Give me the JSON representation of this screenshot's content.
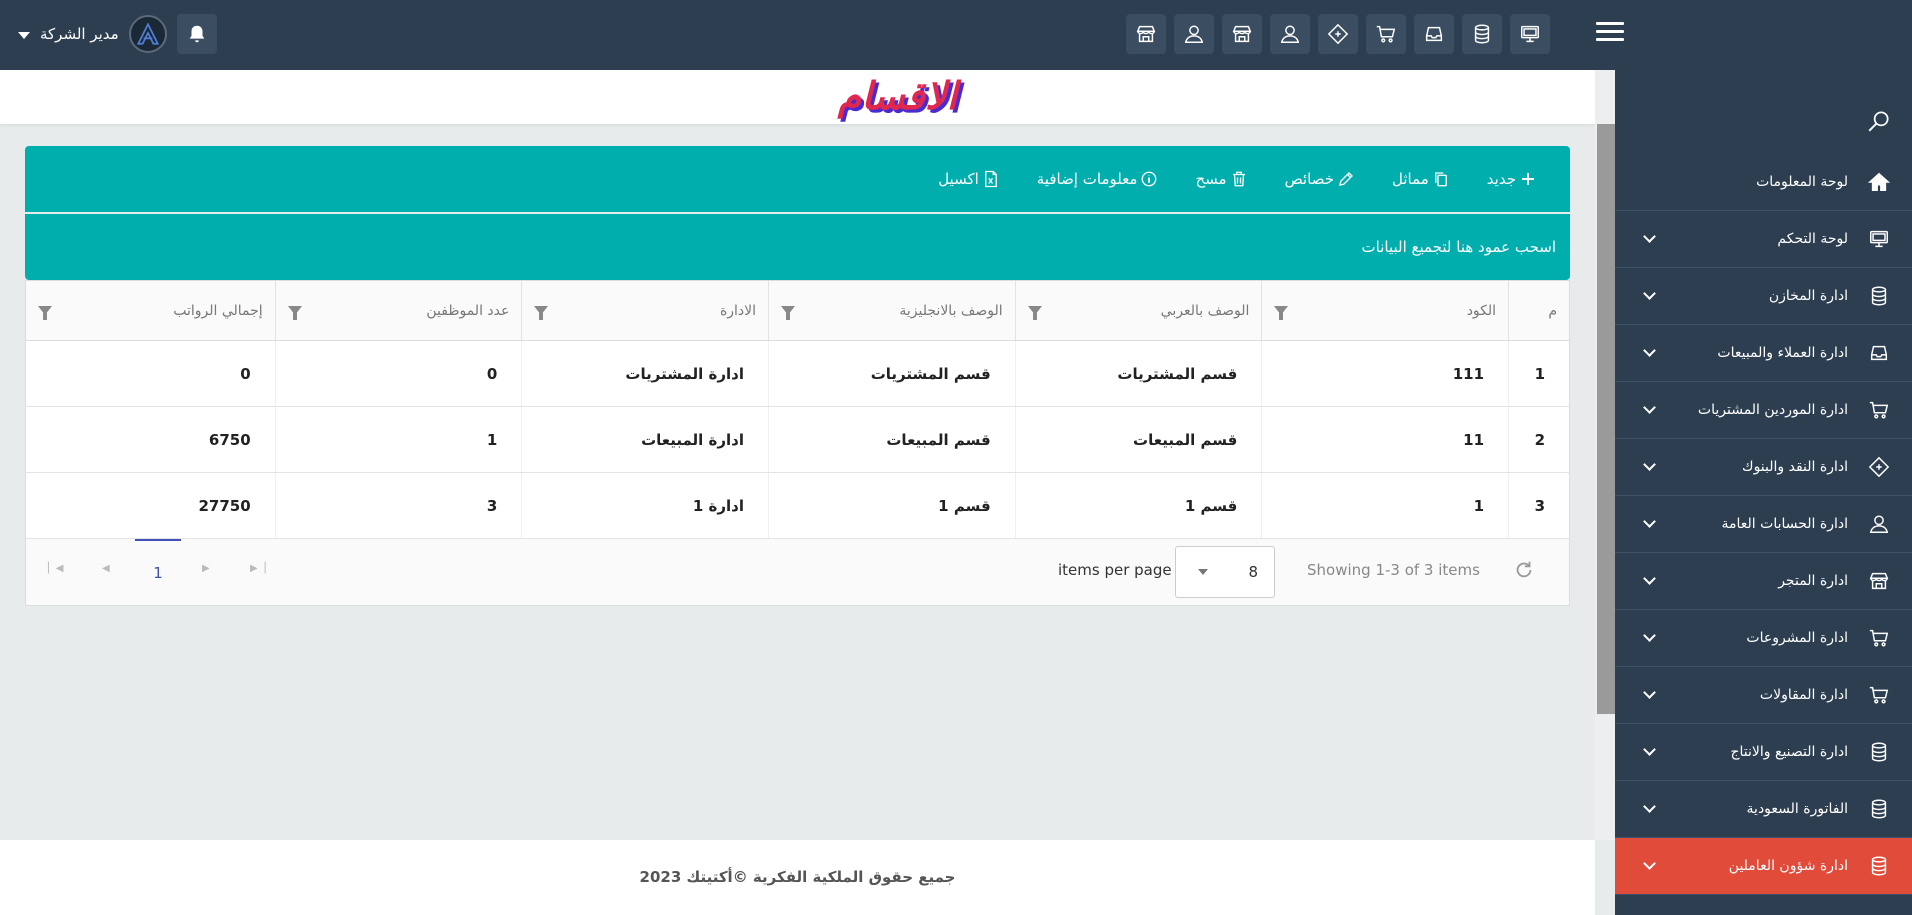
{
  "header": {
    "user_name": "مدير الشركة",
    "top_icons": [
      "monitor-icon",
      "database-icon",
      "inbox-icon",
      "cart-icon",
      "money-icon",
      "user-icon",
      "store-icon",
      "user-icon",
      "store-icon"
    ]
  },
  "page": {
    "title": "الاقسام"
  },
  "toolbar": {
    "new_label": "جديد",
    "copy_label": "مماثل",
    "edit_label": "خصائص",
    "delete_label": "مسح",
    "info_label": "معلومات إضافية",
    "excel_label": "اكسيل"
  },
  "group_bar": {
    "text": "اسحب عمود هنا لتجميع البيانات"
  },
  "grid": {
    "columns": [
      "م",
      "الكود",
      "الوصف بالعربي",
      "الوصف بالانجليزية",
      "الادارة",
      "عدد الموظفين",
      "إجمالي الرواتب"
    ],
    "rows": [
      [
        "1",
        "111",
        "قسم المشتريات",
        "قسم المشتريات",
        "ادارة المشتريات",
        "0",
        "0"
      ],
      [
        "2",
        "11",
        "قسم المبيعات",
        "قسم المبيعات",
        "ادارة المبيعات",
        "1",
        "6750"
      ],
      [
        "3",
        "1",
        "قسم 1",
        "قسم 1",
        "ادارة 1",
        "3",
        "27750"
      ]
    ]
  },
  "pager": {
    "current_page": "1",
    "items_per_page_label": "items per page",
    "items_per_page_value": "8",
    "showing_text": "Showing 1-3 of 3 items"
  },
  "sidebar": {
    "items": [
      {
        "label": "لوحة المعلومات",
        "icon": "home-icon",
        "has_chevron": false
      },
      {
        "label": "لوحة التحكم",
        "icon": "monitor-icon",
        "has_chevron": true
      },
      {
        "label": "ادارة المخازن",
        "icon": "database-icon",
        "has_chevron": true
      },
      {
        "label": "ادارة العملاء والمبيعات",
        "icon": "inbox-icon",
        "has_chevron": true
      },
      {
        "label": "ادارة الموردين المشتريات",
        "icon": "cart-icon",
        "has_chevron": true
      },
      {
        "label": "ادارة النقد والبنوك",
        "icon": "money-icon",
        "has_chevron": true
      },
      {
        "label": "ادارة الحسابات العامة",
        "icon": "user-icon",
        "has_chevron": true
      },
      {
        "label": "ادارة المتجر",
        "icon": "store-icon",
        "has_chevron": true
      },
      {
        "label": "ادارة المشروعات",
        "icon": "cart-icon",
        "has_chevron": true
      },
      {
        "label": "ادارة المقاولات",
        "icon": "cart-icon",
        "has_chevron": true
      },
      {
        "label": "ادارة التصنيع والانتاج",
        "icon": "database-icon",
        "has_chevron": true
      },
      {
        "label": "الفاتورة السعودية",
        "icon": "database-icon",
        "has_chevron": true
      },
      {
        "label": "ادارة شؤون العاملين",
        "icon": "database-icon",
        "has_chevron": true,
        "active": true
      }
    ]
  },
  "footer": {
    "text": "جميع حقوق الملكية الفكرية ©أكتيتك 2023"
  },
  "colors": {
    "topbar": "#2c3e50",
    "sidebar": "#2c3e50",
    "toolbar": "#00aeae",
    "active_item": "#e04b3a",
    "title": "#e0284f",
    "pager_accent": "#3f51b5"
  }
}
